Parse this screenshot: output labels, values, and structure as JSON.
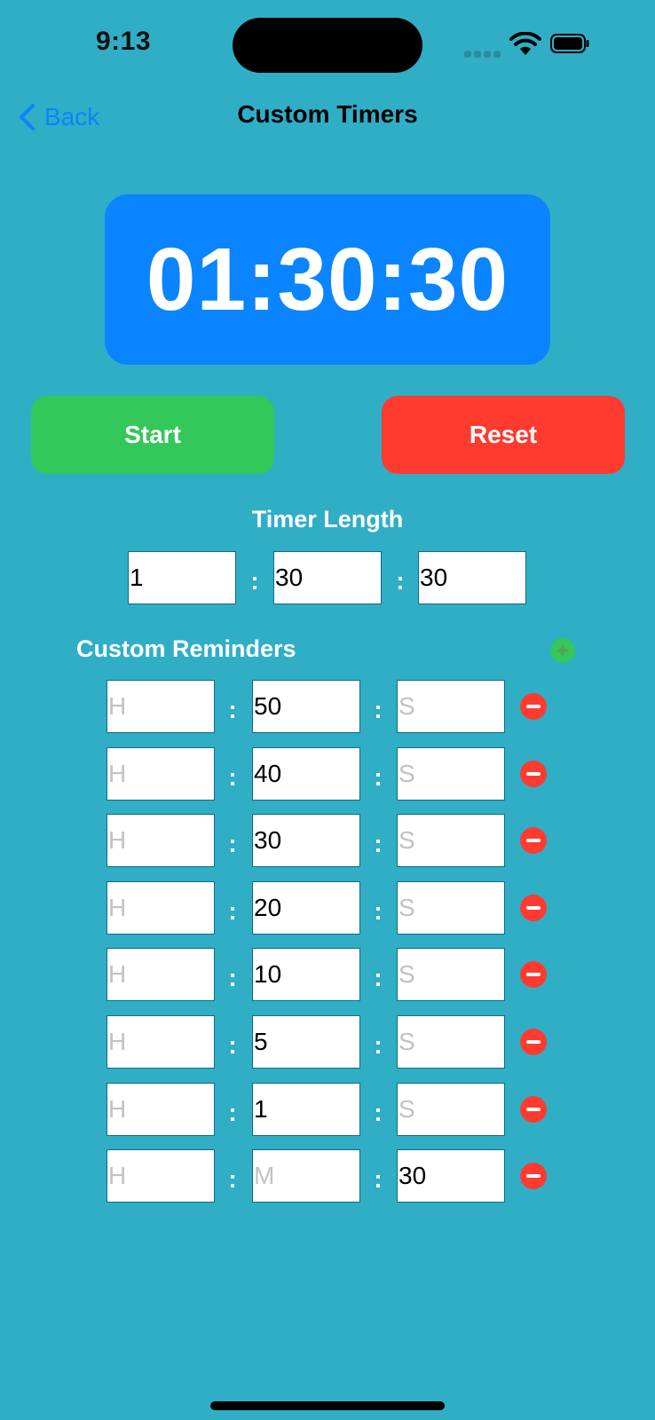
{
  "status_bar": {
    "time": "9:13"
  },
  "nav": {
    "back_label": "Back",
    "title": "Custom Timers"
  },
  "timer": {
    "display": "01:30:30"
  },
  "buttons": {
    "start_label": "Start",
    "reset_label": "Reset"
  },
  "timer_length": {
    "title": "Timer Length",
    "hours": "1",
    "minutes": "30",
    "seconds": "30"
  },
  "reminders": {
    "title": "Custom Reminders",
    "rows": [
      {
        "h": "H",
        "h_placeholder": true,
        "m": "50",
        "m_placeholder": false,
        "s": "S",
        "s_placeholder": true
      },
      {
        "h": "H",
        "h_placeholder": true,
        "m": "40",
        "m_placeholder": false,
        "s": "S",
        "s_placeholder": true
      },
      {
        "h": "H",
        "h_placeholder": true,
        "m": "30",
        "m_placeholder": false,
        "s": "S",
        "s_placeholder": true
      },
      {
        "h": "H",
        "h_placeholder": true,
        "m": "20",
        "m_placeholder": false,
        "s": "S",
        "s_placeholder": true
      },
      {
        "h": "H",
        "h_placeholder": true,
        "m": "10",
        "m_placeholder": false,
        "s": "S",
        "s_placeholder": true
      },
      {
        "h": "H",
        "h_placeholder": true,
        "m": "5",
        "m_placeholder": false,
        "s": "S",
        "s_placeholder": true
      },
      {
        "h": "H",
        "h_placeholder": true,
        "m": "1",
        "m_placeholder": false,
        "s": "S",
        "s_placeholder": true
      },
      {
        "h": "H",
        "h_placeholder": true,
        "m": "M",
        "m_placeholder": true,
        "s": "30",
        "s_placeholder": false
      }
    ]
  },
  "colors": {
    "background": "#30AEC6",
    "display": "#0A84FF",
    "start": "#34C759",
    "reset": "#FF3B30"
  },
  "icons": [
    "chevron-left-icon",
    "signal-icon",
    "wifi-icon",
    "battery-icon",
    "add-circle-icon",
    "remove-circle-icon"
  ]
}
